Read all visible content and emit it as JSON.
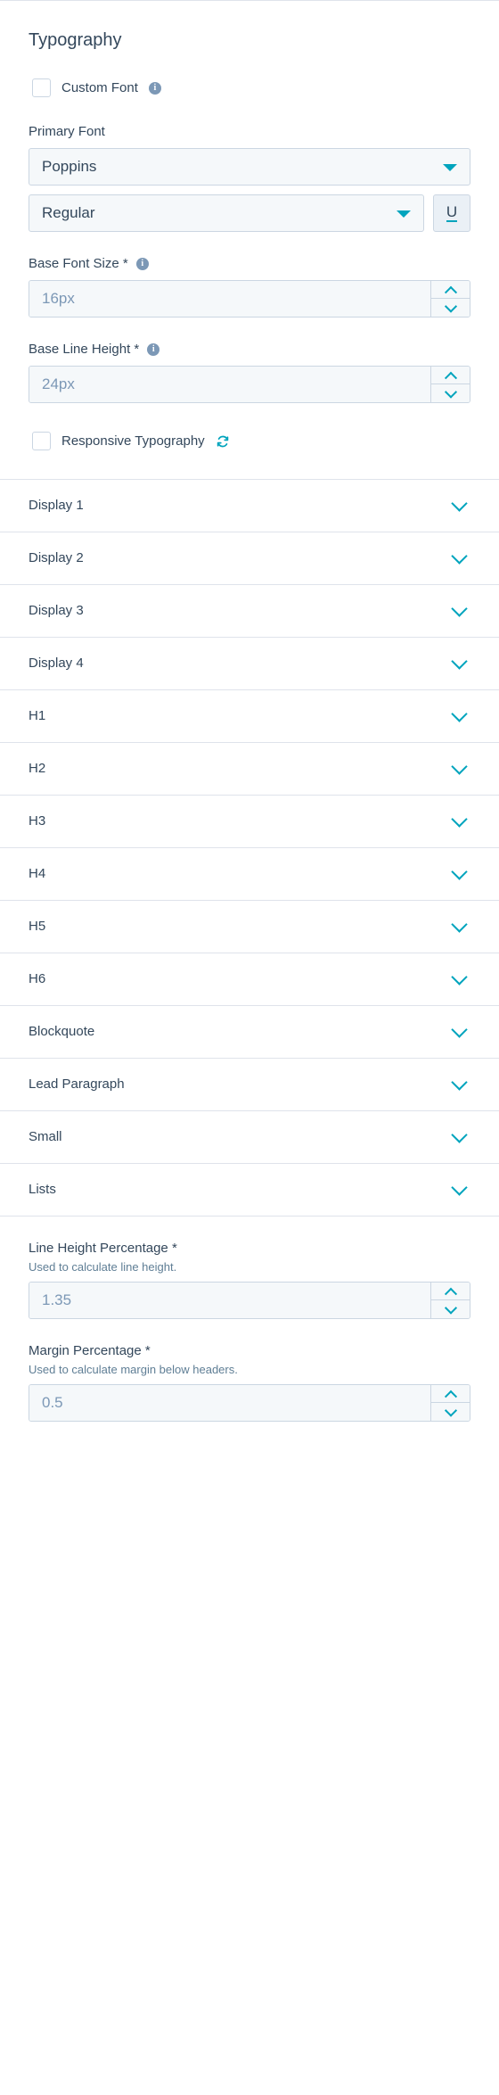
{
  "panel": {
    "title": "Typography"
  },
  "custom_font": {
    "label": "Custom Font",
    "checked": false,
    "info_icon": "info-icon"
  },
  "primary_font": {
    "label": "Primary Font",
    "family_value": "Poppins",
    "weight_value": "Regular",
    "underline_label": "U"
  },
  "base_font_size": {
    "label": "Base Font Size *",
    "value": "16px"
  },
  "base_line_height": {
    "label": "Base Line Height *",
    "value": "24px"
  },
  "responsive_typography": {
    "label": "Responsive Typography",
    "checked": false,
    "refresh_icon": "refresh-icon"
  },
  "accordion": {
    "items": [
      {
        "label": "Display 1"
      },
      {
        "label": "Display 2"
      },
      {
        "label": "Display 3"
      },
      {
        "label": "Display 4"
      },
      {
        "label": "H1"
      },
      {
        "label": "H2"
      },
      {
        "label": "H3"
      },
      {
        "label": "H4"
      },
      {
        "label": "H5"
      },
      {
        "label": "H6"
      },
      {
        "label": "Blockquote"
      },
      {
        "label": "Lead Paragraph"
      },
      {
        "label": "Small"
      },
      {
        "label": "Lists"
      }
    ]
  },
  "line_height_percentage": {
    "label": "Line Height Percentage *",
    "help": "Used to calculate line height.",
    "value": "1.35"
  },
  "margin_percentage": {
    "label": "Margin Percentage *",
    "help": "Used to calculate margin below headers.",
    "value": "0.5"
  },
  "colors": {
    "accent": "#00a4bd",
    "text": "#33475b",
    "muted": "#5f7e95",
    "field_bg": "#f5f8fa",
    "border": "#cbd6e2",
    "divider": "#dfe3eb"
  }
}
